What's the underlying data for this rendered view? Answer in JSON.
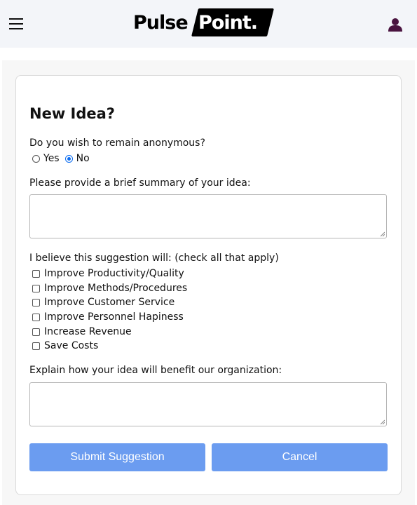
{
  "header": {
    "logo_left": "Pulse",
    "logo_right": "Point.",
    "menu_icon": "hamburger-menu-icon",
    "user_icon": "user-icon"
  },
  "form": {
    "title": "New Idea?",
    "anonymous": {
      "question": "Do you wish to remain anonymous?",
      "options": [
        "Yes",
        "No"
      ],
      "selected": "No"
    },
    "summary": {
      "label": "Please provide a brief summary of your idea:",
      "value": ""
    },
    "benefits": {
      "label": "I believe this suggestion will: (check all that apply)",
      "options": [
        "Improve Productivity/Quality",
        "Improve Methods/Procedures",
        "Improve Customer Service",
        "Improve Personnel Hapiness",
        "Increase Revenue",
        "Save Costs"
      ]
    },
    "explain": {
      "label": "Explain how your idea will benefit our organization:",
      "value": ""
    },
    "buttons": {
      "submit": "Submit Suggestion",
      "cancel": "Cancel"
    }
  },
  "colors": {
    "accent": "#6b9cf0",
    "radio_selected": "#0b6cf0",
    "header_bg": "#f3f5f9"
  }
}
